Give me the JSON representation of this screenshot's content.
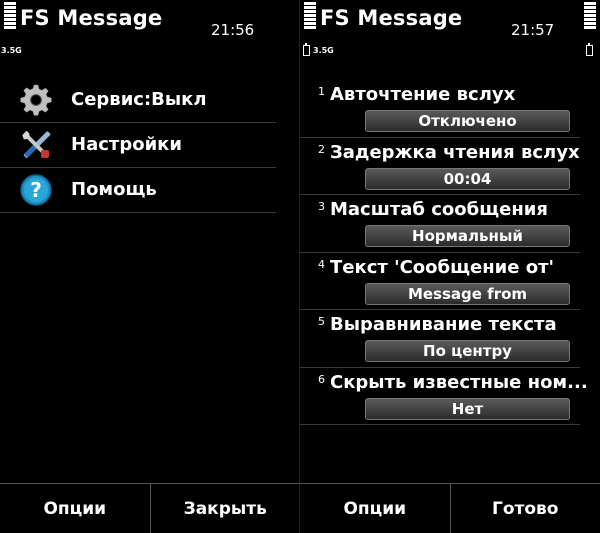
{
  "left": {
    "app_title": "FS Message",
    "time": "21:56",
    "network": "3.5G",
    "menu": [
      {
        "label": "Сервис:Выкл",
        "icon": "gear-icon"
      },
      {
        "label": "Настройки",
        "icon": "tools-icon"
      },
      {
        "label": "Помощь",
        "icon": "help-icon"
      }
    ],
    "softkeys": {
      "left": "Опции",
      "right": "Закрыть"
    }
  },
  "right": {
    "app_title": "FS Message",
    "time": "21:57",
    "network": "3.5G",
    "settings": [
      {
        "num": "1",
        "label": "Авточтение вслух",
        "value": "Отключено"
      },
      {
        "num": "2",
        "label": "Задержка чтения вслух",
        "value": "00:04"
      },
      {
        "num": "3",
        "label": "Масштаб сообщения",
        "value": "Нормальный"
      },
      {
        "num": "4",
        "label": "Текст 'Сообщение от'",
        "value": "Message from"
      },
      {
        "num": "5",
        "label": "Выравнивание текста",
        "value": "По центру"
      },
      {
        "num": "6",
        "label": "Скрыть известные ном...",
        "value": "Нет"
      }
    ],
    "softkeys": {
      "left": "Опции",
      "right": "Готово"
    }
  },
  "colors": {
    "background": "#000000",
    "text": "#ffffff",
    "value_box_top": "#5a5a5a",
    "value_box_bottom": "#2b2b2b",
    "divider": "#3a3a3a"
  }
}
